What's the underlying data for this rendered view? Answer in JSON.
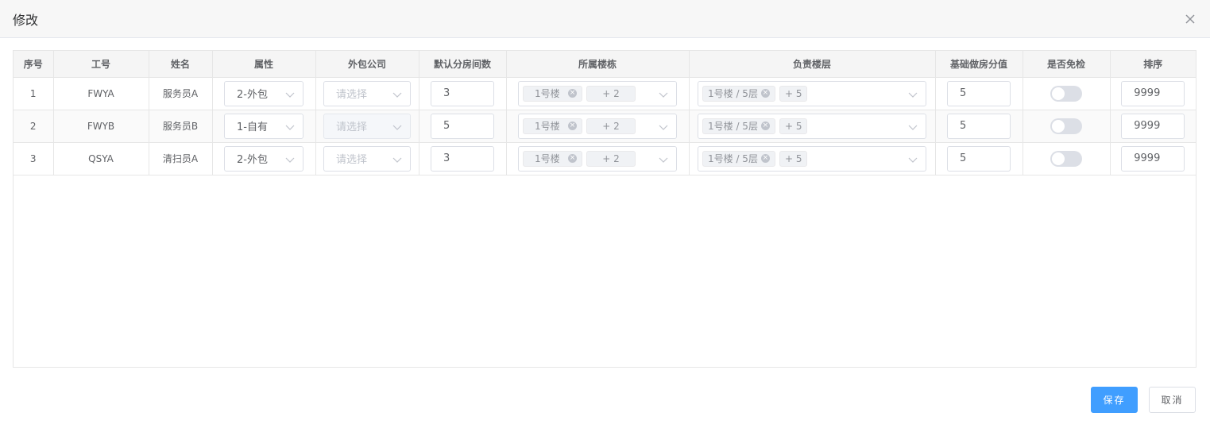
{
  "dialog": {
    "title": "修改",
    "close_icon": "close-icon"
  },
  "table": {
    "headers": [
      "序号",
      "工号",
      "姓名",
      "属性",
      "外包公司",
      "默认分房间数",
      "所属楼栋",
      "负责楼层",
      "基础做房分值",
      "是否免检",
      "排序"
    ],
    "rows": [
      {
        "index": "1",
        "code": "FWYA",
        "name": "服务员A",
        "attribute": "2-外包",
        "company": "请选择",
        "company_disabled": false,
        "rooms": "3",
        "building_tag": "1号楼",
        "building_more": "+ 2",
        "floor_tag": "1号楼 / 5层",
        "floor_more": "+ 5",
        "score": "5",
        "exempt": false,
        "sort": "9999"
      },
      {
        "index": "2",
        "code": "FWYB",
        "name": "服务员B",
        "attribute": "1-自有",
        "company": "请选择",
        "company_disabled": true,
        "rooms": "5",
        "building_tag": "1号楼",
        "building_more": "+ 2",
        "floor_tag": "1号楼 / 5层",
        "floor_more": "+ 5",
        "score": "5",
        "exempt": false,
        "sort": "9999"
      },
      {
        "index": "3",
        "code": "QSYA",
        "name": "清扫员A",
        "attribute": "2-外包",
        "company": "请选择",
        "company_disabled": false,
        "rooms": "3",
        "building_tag": "1号楼",
        "building_more": "+ 2",
        "floor_tag": "1号楼 / 5层",
        "floor_more": "+ 5",
        "score": "5",
        "exempt": false,
        "sort": "9999"
      }
    ]
  },
  "footer": {
    "save_label": "保存",
    "cancel_label": "取消"
  },
  "colors": {
    "primary": "#409eff",
    "header_bg": "#f7f7f7",
    "switch_off": "#dcdfe6"
  }
}
